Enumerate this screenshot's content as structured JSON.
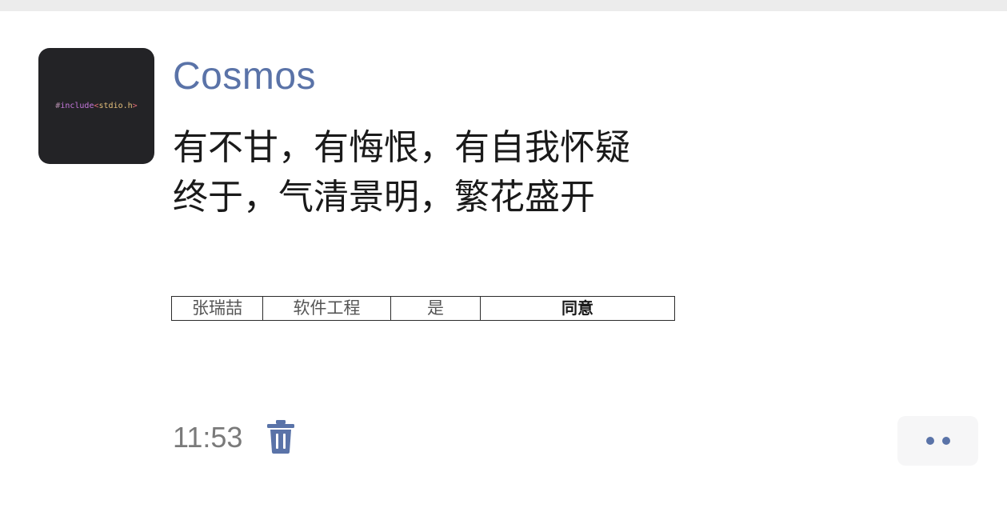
{
  "post": {
    "avatar_code": {
      "hash": "#",
      "keyword": "include",
      "open": "<",
      "lib": "stdio.h",
      "close": ">"
    },
    "username": "Cosmos",
    "lines": [
      "有不甘，有悔恨，有自我怀疑",
      "终于，气清景明，繁花盛开"
    ],
    "table": [
      [
        "张瑞喆",
        "软件工程",
        "是",
        "同意"
      ]
    ],
    "time": "11:53",
    "delete_icon": "trash-icon",
    "more_icon": "more-dots-icon",
    "colors": {
      "accent": "#5a73a8",
      "text": "#1a1a1a",
      "muted": "#7a7a7a"
    }
  }
}
